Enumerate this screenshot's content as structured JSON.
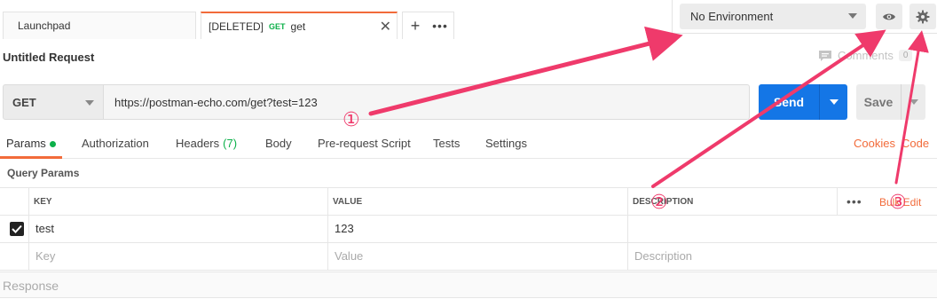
{
  "tabs": {
    "launchpad": "Launchpad",
    "active": {
      "deleted_prefix": "[DELETED]",
      "method": "GET",
      "name": "get"
    }
  },
  "environment": {
    "selected": "No Environment"
  },
  "request": {
    "title": "Untitled Request",
    "comments_label": "Comments",
    "comments_count": "0",
    "method": "GET",
    "url": "https://postman-echo.com/get?test=123",
    "send_label": "Send",
    "save_label": "Save"
  },
  "request_tabs": {
    "params": "Params",
    "authorization": "Authorization",
    "headers": "Headers",
    "headers_count": "(7)",
    "body": "Body",
    "prerequest": "Pre-request Script",
    "tests": "Tests",
    "settings": "Settings",
    "cookies": "Cookies",
    "code": "Code"
  },
  "query_params": {
    "title": "Query Params",
    "columns": {
      "key": "KEY",
      "value": "VALUE",
      "description": "DESCRIPTION"
    },
    "bulk_edit": "Bulk Edit",
    "rows": [
      {
        "checked": true,
        "key": "test",
        "value": "123",
        "description": ""
      }
    ],
    "placeholders": {
      "key": "Key",
      "value": "Value",
      "description": "Description"
    }
  },
  "response": {
    "label": "Response"
  },
  "annotations": {
    "marker_1": "①",
    "marker_2": "②",
    "marker_3": "③",
    "color": "#ef3a6b"
  },
  "colors": {
    "accent": "#f26b3a",
    "send": "#1476e6",
    "green": "#0cb04a"
  }
}
